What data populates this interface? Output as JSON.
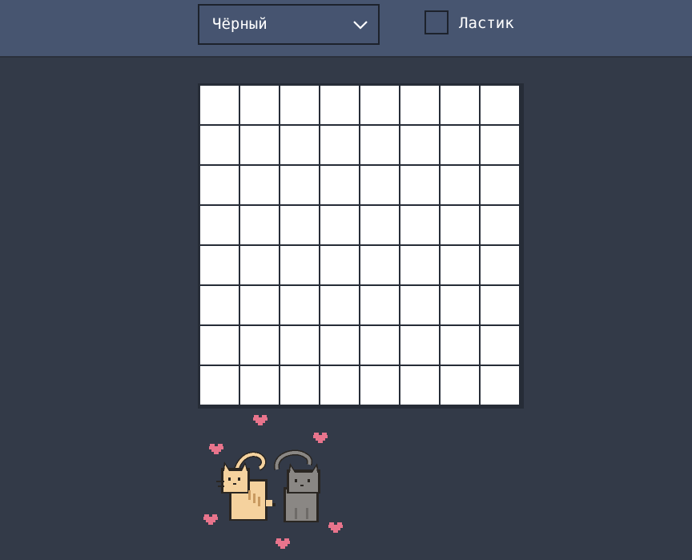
{
  "toolbar": {
    "color_select": {
      "selected": "Чёрный",
      "icon": "chevron-down-icon"
    },
    "eraser": {
      "label": "Ластик",
      "checked": false
    }
  },
  "canvas": {
    "rows": 8,
    "cols": 8,
    "cell_color": "#ffffff"
  },
  "colors": {
    "toolbar_bg": "#475570",
    "page_bg": "#333a48",
    "grid_line": "#262c37",
    "heart": "#e8748c",
    "cat_orange": "#f5d29e",
    "cat_gray": "#8a8784"
  },
  "decoration": {
    "icon": "cats-with-hearts-icon"
  }
}
